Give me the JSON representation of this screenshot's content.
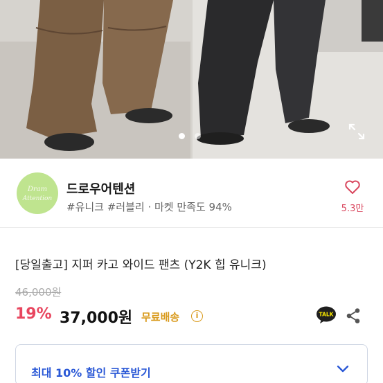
{
  "gallery": {
    "active_index": 0,
    "dot_count": 2,
    "expand_icon": "expand-icon"
  },
  "shop": {
    "logo_text_line1": "Dram",
    "logo_text_line2": "Attention",
    "name": "드로우어텐션",
    "meta": "#유니크 #러블리 · 마켓 만족도 94%",
    "like_icon": "heart-icon",
    "like_count": "5.3만"
  },
  "product": {
    "title": "[당일출고] 지퍼 카고 와이드 팬츠 (Y2K 힙 유니크)",
    "original_price": "46,000원",
    "discount": "19%",
    "price": "37,000원",
    "shipping": "무료배송",
    "info_icon": "i"
  },
  "actions": {
    "talk_label": "TALK",
    "share_icon": "share-icon"
  },
  "coupon": {
    "label": "최대 10% 할인 쿠폰받기",
    "chevron_icon": "chevron-down-icon"
  },
  "colors": {
    "accent_pink": "#e8465f",
    "accent_blue": "#2a58d6",
    "shipping_gold": "#d99a1c",
    "logo_green": "#bfe48f"
  }
}
